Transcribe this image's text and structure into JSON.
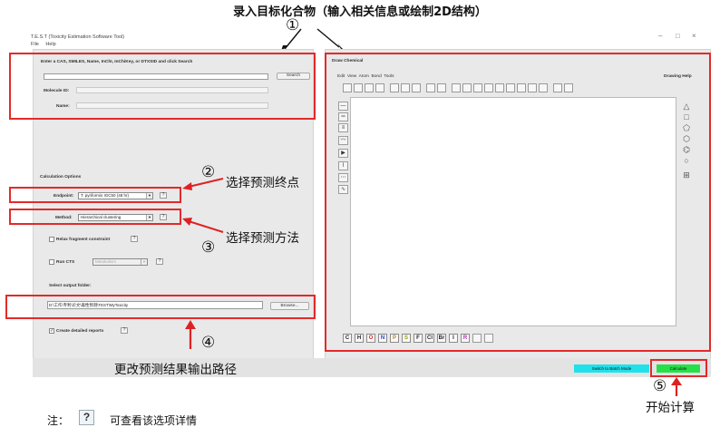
{
  "captions": {
    "top": "录入目标化合物（输入相关信息或绘制2D结构）",
    "circle1": "①",
    "ann2": "选择预测终点",
    "circle2": "②",
    "ann3": "选择预测方法",
    "circle3": "③",
    "ann4": "更改预测结果输出路径",
    "circle4": "④",
    "circle5": "⑤",
    "ann5": "开始计算",
    "note_prefix": "注：",
    "note_icon": "?",
    "note_text": "可查看该选项详情"
  },
  "window": {
    "title": "T.E.S.T (Toxicity Estimation Software Tool)",
    "menu": [
      "File",
      "Help"
    ],
    "controls": {
      "minimize": "–",
      "maximize": "□",
      "close": "×"
    }
  },
  "search": {
    "heading": "Enter a CAS, SMILES, Name, InChI, InChiKey, or DTXSID and click Search",
    "input_value": "",
    "button": "Search",
    "molecule_id_label": "Molecule ID:",
    "name_label": "Name:"
  },
  "calc_options": {
    "heading": "Calculation Options",
    "endpoint_label": "Endpoint:",
    "endpoint_value": "T. pyriformis IGC50 (48 hr)",
    "method_label": "Method:",
    "method_value": "Hierarchical clustering",
    "relax_label": "Relax fragment constraint",
    "run_cts_label": "Run CTS",
    "run_cts_value": "Metabolism",
    "output_label": "Select output folder:",
    "output_path": "D:\\工作\\专利\\论文\\毒性预测\\TEST\\MyToxicity",
    "browse_button": "Browse...",
    "detailed_label": "Create detailed reports",
    "help": "?"
  },
  "draw": {
    "heading": "Draw Chemical",
    "menu": [
      "Edit",
      "View",
      "Atom",
      "Bond",
      "Tools"
    ],
    "drawing_help": "Drawing Help",
    "elements": [
      "C",
      "H",
      "O",
      "N",
      "P",
      "S",
      "F",
      "Cl",
      "Br",
      "I",
      "R"
    ]
  },
  "bottom": {
    "batch_button": "Switch to Batch Mode",
    "calculate_button": "Calculate"
  },
  "colors": {
    "annotation_red": "#e32a2a",
    "batch_cyan": "#20e1ea",
    "calculate_green": "#27e047"
  }
}
